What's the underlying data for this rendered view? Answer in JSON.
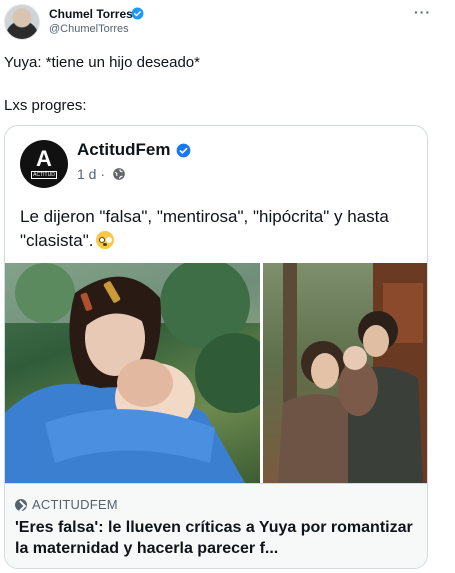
{
  "tweet": {
    "author_name": "Chumel Torres",
    "author_handle": "@ChumelTorres",
    "more_label": "···",
    "line1": "Yuya: *tiene un hijo deseado*",
    "line2": "Lxs progres:"
  },
  "quoted_post": {
    "page_name": "ActitudFem",
    "logo_letter": "A",
    "logo_tag": "ACTITUD",
    "meta": "1 d ·",
    "text": "Le dijeron \"falsa\", \"mentirosa\", \"hipócrita\" y hasta \"clasista\".",
    "link": {
      "site": "ACTITUDFEM",
      "headline": "'Eres falsa': le llueven críticas a Yuya por romantizar la maternidad y hacerla parecer f..."
    }
  },
  "icons": {
    "verified": "verified-badge-icon",
    "globe": "globe-icon",
    "link": "link-icon",
    "emoji": "flushed-face-emoji"
  },
  "colors": {
    "verified_blue": "#1d9bf0",
    "text_primary": "#0f1419",
    "text_secondary": "#536471",
    "border": "#cfd9de"
  }
}
